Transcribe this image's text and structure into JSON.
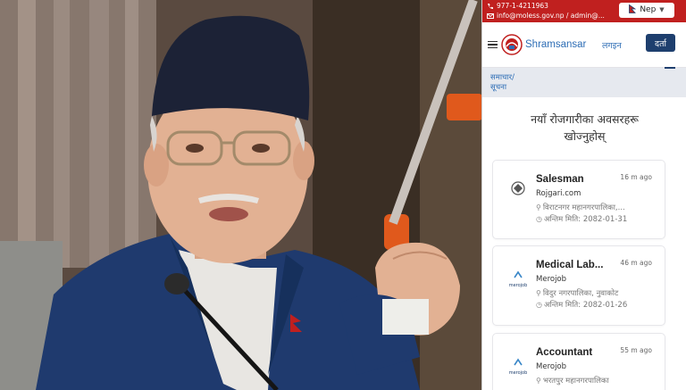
{
  "topbar": {
    "phone": "977-1-4211963",
    "email": "info@moless.gov.np / admin@...",
    "language": "Nep",
    "flag_icon": "nepal-flag-icon"
  },
  "header": {
    "brand": "Shramsansar",
    "login": "लगइन",
    "register": "दर्ता"
  },
  "news_label_line1": "समाचार/",
  "news_label_line2": "सूचना",
  "section_title_line1": "नयाँ रोजगारीका अवसरहरू",
  "section_title_line2": "खोज्नुहोस्",
  "jobs": [
    {
      "title": "Salesman",
      "company": "Rojgari.com",
      "posted": "16 m ago",
      "location": "विराटनगर महानगरपालिका,...",
      "deadline": "अन्तिम मिति: 2082-01-31"
    },
    {
      "title": "Medical Lab...",
      "company": "Merojob",
      "posted": "46 m ago",
      "location": "विदुर नगरपालिका, नुवाकोट",
      "deadline": "अन्तिम मिति: 2082-01-26"
    },
    {
      "title": "Accountant",
      "company": "Merojob",
      "posted": "55 m ago",
      "location": "भरतपुर महानगरपालिका",
      "deadline": ""
    }
  ],
  "merojob_logo_text": "merojob",
  "colors": {
    "topbar": "#c0201f",
    "brand": "#2d6db5",
    "register_button": "#1e3f6e",
    "suit": "#1f3a6e",
    "cap": "#1c2236"
  }
}
